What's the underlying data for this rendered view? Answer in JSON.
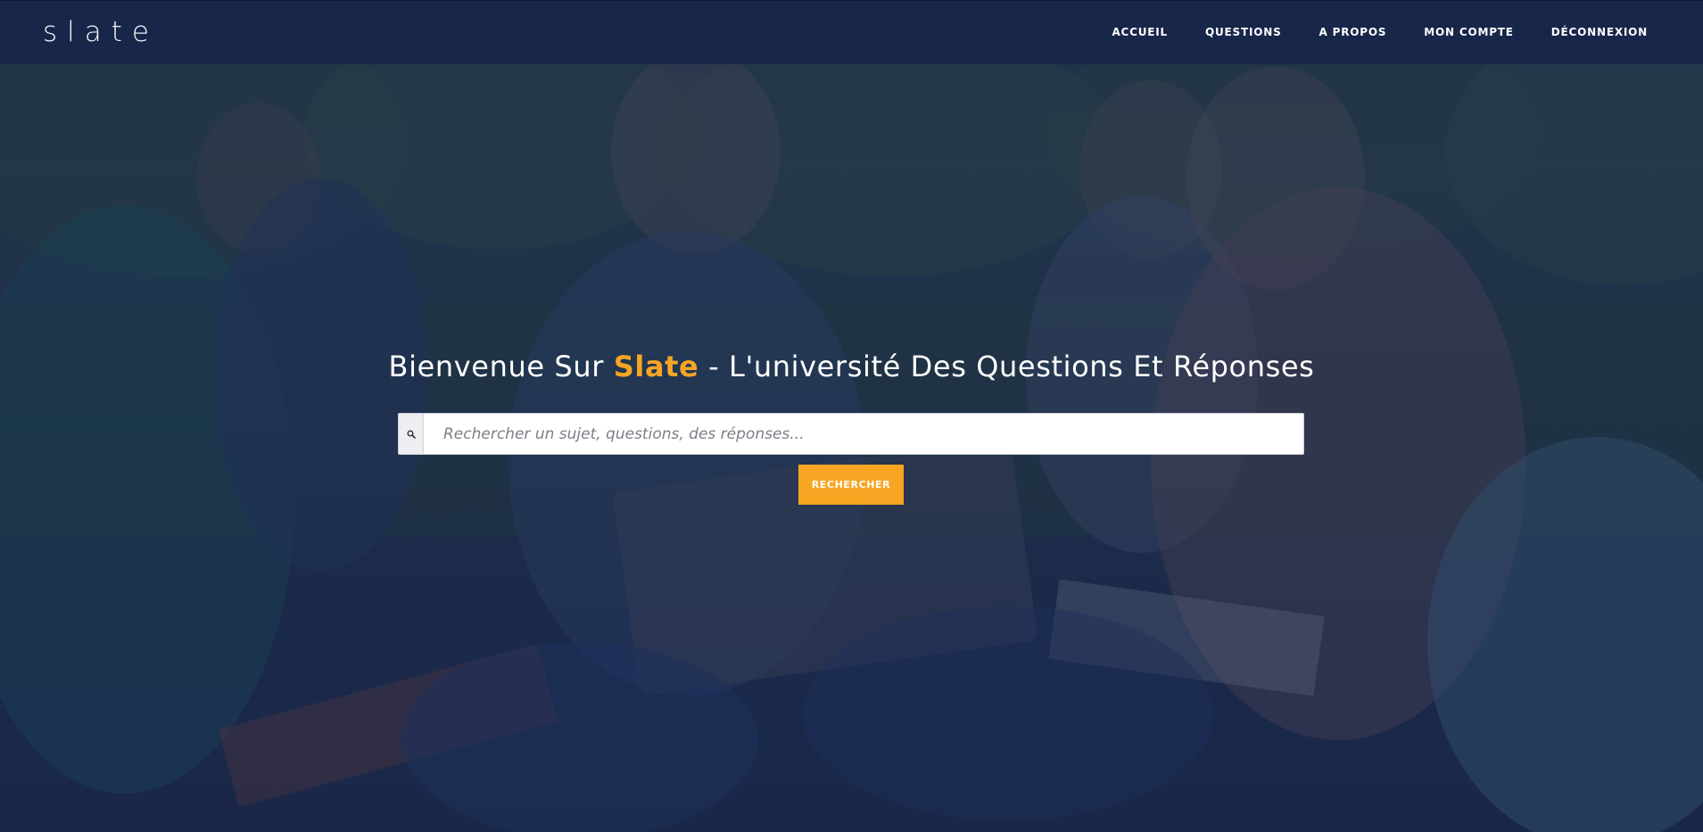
{
  "navbar": {
    "logo": "slate",
    "links": [
      {
        "label": "ACCUEIL"
      },
      {
        "label": "QUESTIONS"
      },
      {
        "label": "A PROPOS"
      },
      {
        "label": "MON COMPTE"
      },
      {
        "label": "DÉCONNEXION"
      }
    ]
  },
  "hero": {
    "headline_prefix": "Bienvenue Sur ",
    "headline_brand": "Slate",
    "headline_suffix": " - L'université Des Questions Et Réponses",
    "search": {
      "icon": "search-icon",
      "placeholder": "Rechercher un sujet, questions, des réponses...",
      "value": ""
    },
    "search_button_label": "RECHERCHER"
  },
  "colors": {
    "navbar_bg": "#18264a",
    "accent": "#f6a623",
    "overlay": "#182648",
    "text": "#ffffff"
  }
}
